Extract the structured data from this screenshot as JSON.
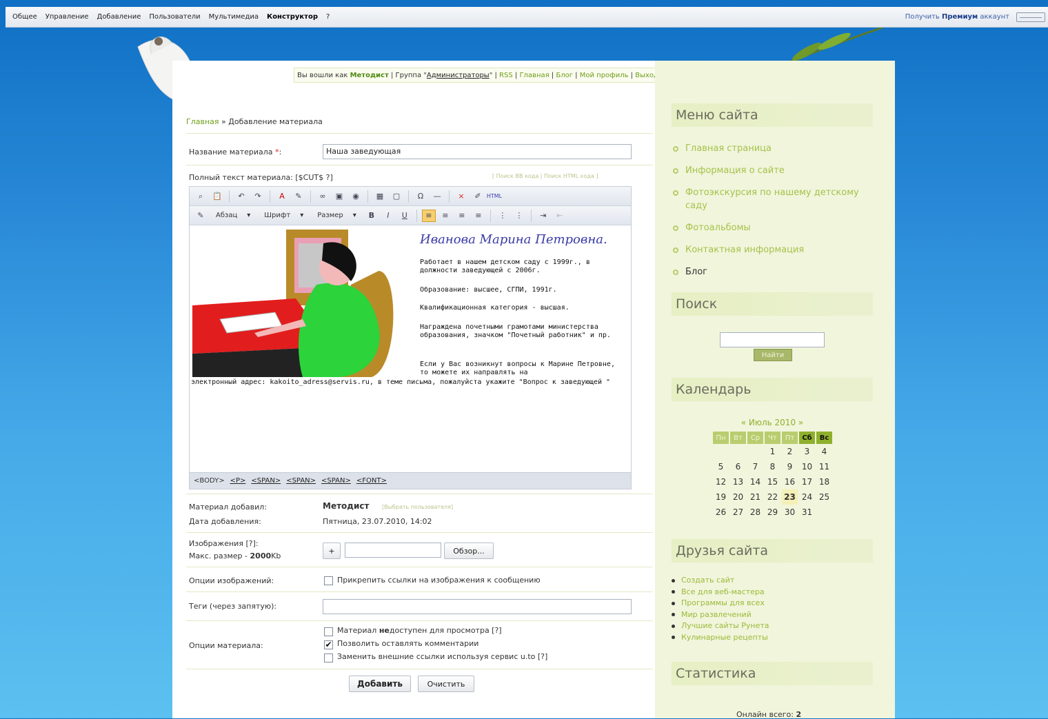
{
  "topbar": {
    "menu": [
      "Общее",
      "Управление",
      "Добавление",
      "Пользователи",
      "Мультимедиа",
      "Конструктор",
      "?"
    ],
    "right_prefix": "Получить",
    "right_bold": "Премиум",
    "right_suffix": "аккаунт"
  },
  "loginbar": {
    "prefix": "Вы вошли как",
    "user": "Методист",
    "group_prefix": "| Группа \"",
    "group": "Администраторы",
    "group_suffix": "\" |",
    "links": [
      "RSS",
      "Главная",
      "Блог",
      "Мой профиль",
      "Выход"
    ]
  },
  "breadcrumb": {
    "home": "Главная",
    "sep": "»",
    "current": "Добавление материала"
  },
  "form": {
    "title_label": "Название материала",
    "title_value": "Наша заведующая",
    "fulltext_label": "Полный текст материала: [$CUT$ ?]",
    "fulltext_links": "[ Поиск ВВ кода | Поиск HTML кода ]",
    "toolbar": {
      "paragraph": "Абзац",
      "font": "Шрифт",
      "size": "Размер"
    },
    "editor": {
      "heading": "Иванова Марина Петровна.",
      "p1": "Работает в нашем детском саду с 1999г., в должности заведующей  с 2006г.",
      "p2": "Образование: высшее, СГПИ, 1991г.",
      "p3": "Квалификационная категория - высшая.",
      "p4": "Награждена почетными грамотами министерства образования, значком \"Почетный работник\" и пр.",
      "p5": "Если у Вас возникнут вопросы к Марине Петровне, то можете их направлять на",
      "p6": "электронный адрес: kakoito_adress@servis.ru, в теме письма, пожалуйста укажите \"Вопрос к заведующей \""
    },
    "statusbar": [
      "<BODY>",
      "<P>",
      "<SPAN>",
      "<SPAN>",
      "<SPAN>",
      "<FONT>"
    ],
    "added_by_label": "Материал добавил:",
    "added_by_value": "Методист",
    "added_by_link": "[Выбрать пользователя]",
    "date_label": "Дата добавления:",
    "date_value": "Пятница, 23.07.2010, 14:02",
    "images_label": "Изображения [?]:",
    "max_size_label": "Макс. размер -",
    "max_size_value": "2000",
    "max_size_unit": "Kb",
    "browse_button": "Обзор...",
    "plus_button": "+",
    "image_options_label": "Опции изображений:",
    "image_option": "Прикрепить ссылки на изображения к сообщению",
    "tags_label": "Теги (через запятую):",
    "material_options_label": "Опции материала:",
    "opt1_a": "Материал",
    "opt1_b": "не",
    "opt1_c": "доступен для просмотра [?]",
    "opt2": "Позволить оставлять комментарии",
    "opt2_checked": true,
    "opt3": "Заменить внешние ссылки используя сервис u.to [?]",
    "add_button": "Добавить",
    "clear_button": "Очистить"
  },
  "sidebar": {
    "menu_title": "Меню сайта",
    "menu_items": [
      "Главная страница",
      "Информация о сайте",
      "Фотоэкскурсия по нашему детскому саду",
      "Фотоальбомы",
      "Контактная информация",
      "Блог"
    ],
    "search_title": "Поиск",
    "search_button": "Найти",
    "calendar_title": "Календарь",
    "calendar": {
      "month": "« Июль 2010 »",
      "days": [
        "Пн",
        "Вт",
        "Ср",
        "Чт",
        "Пт",
        "Сб",
        "Вс"
      ],
      "weeks": [
        [
          "",
          "",
          "",
          "1",
          "2",
          "3",
          "4"
        ],
        [
          "5",
          "6",
          "7",
          "8",
          "9",
          "10",
          "11"
        ],
        [
          "12",
          "13",
          "14",
          "15",
          "16",
          "17",
          "18"
        ],
        [
          "19",
          "20",
          "21",
          "22",
          "23",
          "24",
          "25"
        ],
        [
          "26",
          "27",
          "28",
          "29",
          "30",
          "31",
          ""
        ]
      ],
      "today": "23"
    },
    "friends_title": "Друзья сайта",
    "friends": [
      "Создать сайт",
      "Все для веб-мастера",
      "Программы для всех",
      "Мир развлечений",
      "Лучшие сайты Рунета",
      "Кулинарные рецепты"
    ],
    "stats_title": "Статистика",
    "online_label": "Онлайн всего:",
    "online_value": "2"
  }
}
